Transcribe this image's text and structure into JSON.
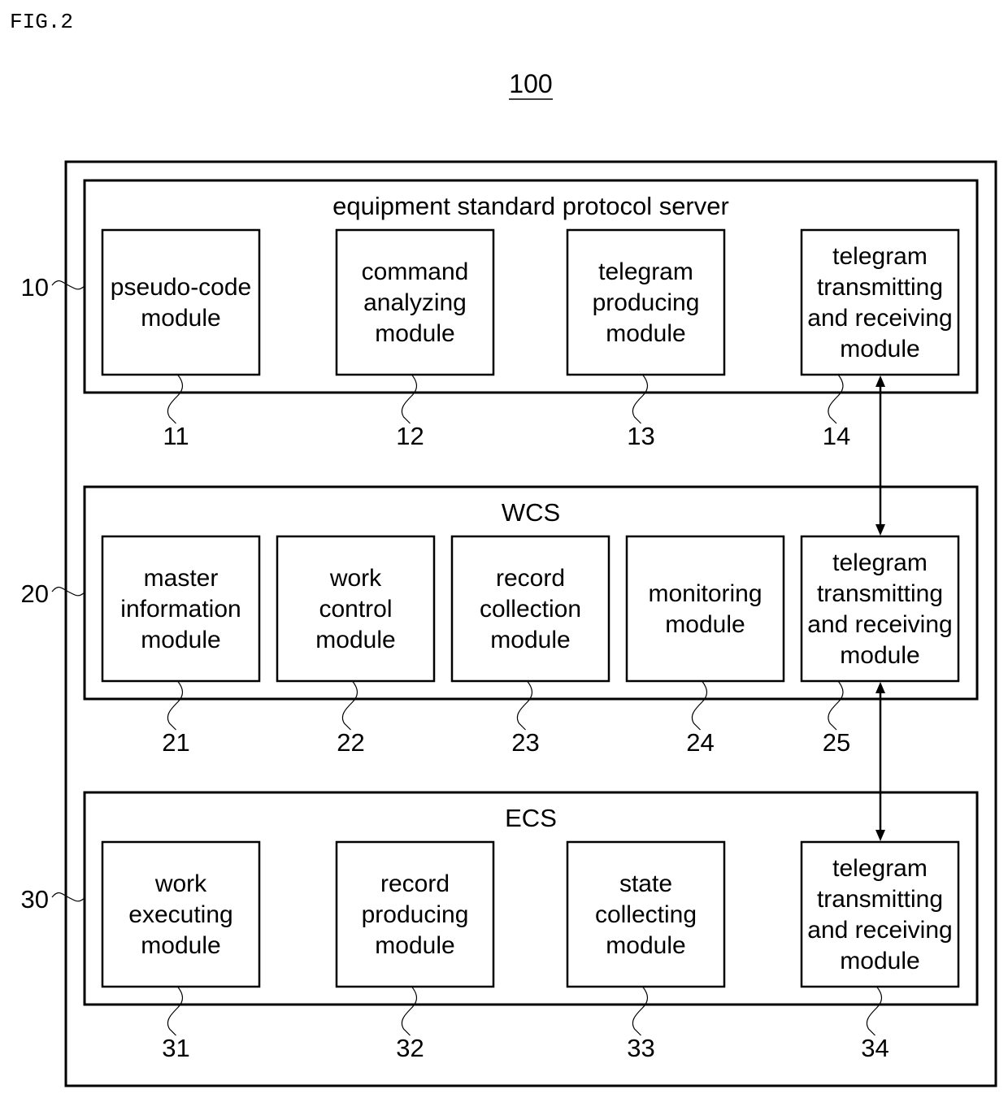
{
  "figure": {
    "label": "FIG.2",
    "system_ref": "100"
  },
  "panels": [
    {
      "id": "server",
      "ref": "10",
      "title": "equipment standard protocol server",
      "modules": [
        {
          "ref": "11",
          "lines": [
            "pseudo-code",
            "module"
          ]
        },
        {
          "ref": "12",
          "lines": [
            "command",
            "analyzing",
            "module"
          ]
        },
        {
          "ref": "13",
          "lines": [
            "telegram",
            "producing",
            "module"
          ]
        },
        {
          "ref": "14",
          "lines": [
            "telegram",
            "transmitting",
            "and receiving",
            "module"
          ]
        }
      ]
    },
    {
      "id": "wcs",
      "ref": "20",
      "title": "WCS",
      "modules": [
        {
          "ref": "21",
          "lines": [
            "master",
            "information",
            "module"
          ]
        },
        {
          "ref": "22",
          "lines": [
            "work",
            "control",
            "module"
          ]
        },
        {
          "ref": "23",
          "lines": [
            "record",
            "collection",
            "module"
          ]
        },
        {
          "ref": "24",
          "lines": [
            "monitoring",
            "module"
          ]
        },
        {
          "ref": "25",
          "lines": [
            "telegram",
            "transmitting",
            "and receiving",
            "module"
          ]
        }
      ]
    },
    {
      "id": "ecs",
      "ref": "30",
      "title": "ECS",
      "modules": [
        {
          "ref": "31",
          "lines": [
            "work",
            "executing",
            "module"
          ]
        },
        {
          "ref": "32",
          "lines": [
            "record",
            "producing",
            "module"
          ]
        },
        {
          "ref": "33",
          "lines": [
            "state",
            "collecting",
            "module"
          ]
        },
        {
          "ref": "34",
          "lines": [
            "telegram",
            "transmitting",
            "and receiving",
            "module"
          ]
        }
      ]
    }
  ],
  "connections": [
    {
      "from": "14",
      "to": "25",
      "type": "bidirectional"
    },
    {
      "from": "25",
      "to": "34",
      "type": "bidirectional"
    }
  ]
}
